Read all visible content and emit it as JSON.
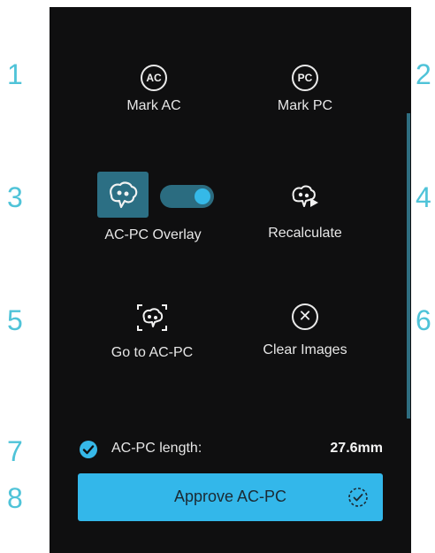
{
  "annotations": [
    "1",
    "2",
    "3",
    "4",
    "5",
    "6",
    "7",
    "8"
  ],
  "tools": {
    "mark_ac": {
      "icon_text": "AC",
      "label": "Mark AC"
    },
    "mark_pc": {
      "icon_text": "PC",
      "label": "Mark PC"
    },
    "overlay": {
      "label": "AC-PC Overlay",
      "toggle_on": true
    },
    "recalculate": {
      "label": "Recalculate"
    },
    "go_to": {
      "label": "Go to AC-PC"
    },
    "clear": {
      "label": "Clear Images"
    }
  },
  "length": {
    "label": "AC-PC length:",
    "value": "27.6mm"
  },
  "approve": {
    "label": "Approve AC-PC"
  },
  "colors": {
    "accent": "#33b7ea",
    "annotation": "#4fc3d8",
    "panel_bg": "#0f0f10",
    "overlay_bg": "#2c6f84"
  },
  "icons": {
    "mark_ac": "ac-circle-icon",
    "mark_pc": "pc-circle-icon",
    "overlay": "brain-icon",
    "recalculate": "brain-play-icon",
    "go_to": "brain-focus-icon",
    "clear": "close-circle-icon",
    "length": "check-circle-icon",
    "approve": "dashed-check-circle-icon"
  }
}
